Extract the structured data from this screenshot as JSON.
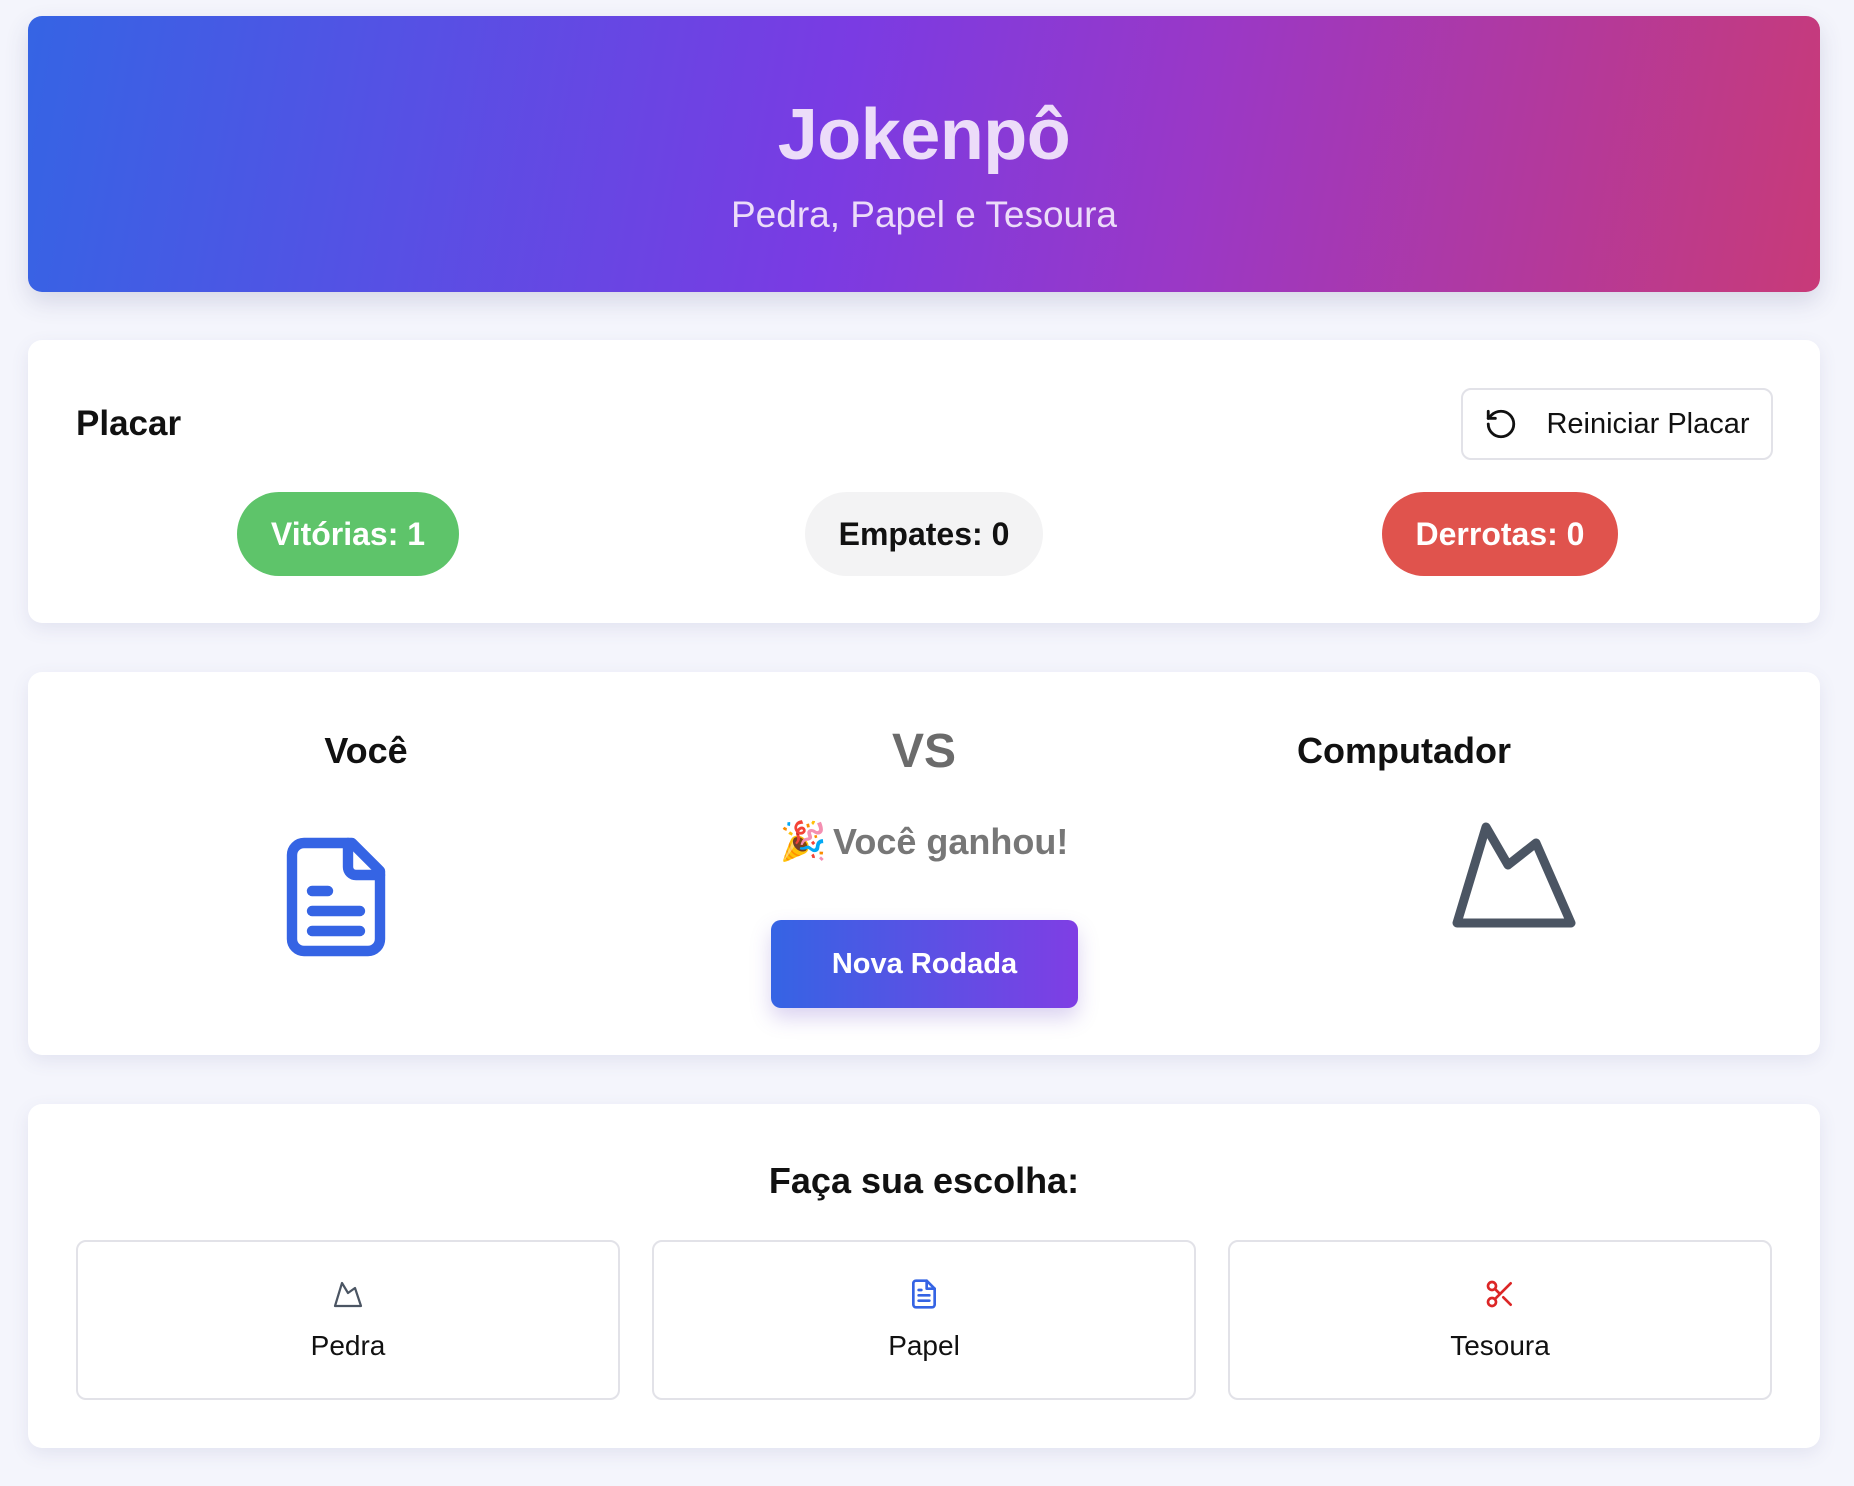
{
  "header": {
    "title": "Jokenpô",
    "subtitle": "Pedra, Papel e Tesoura"
  },
  "scoreboard": {
    "title": "Placar",
    "reset_label": "Reiniciar Placar",
    "reset_icon": "rotate-ccw-icon",
    "wins_label": "Vitórias: 1",
    "draws_label": "Empates: 0",
    "losses_label": "Derrotas: 0",
    "colors": {
      "win": "#5ec46a",
      "draw": "#f3f3f4",
      "loss": "#e0534d"
    }
  },
  "battle": {
    "player_label": "Você",
    "vs_label": "VS",
    "computer_label": "Computador",
    "player_choice_icon": "file-text-icon",
    "computer_choice_icon": "mountain-icon",
    "result_emoji": "🎉",
    "result_text": "Você ganhou!",
    "new_round_label": "Nova Rodada"
  },
  "choices": {
    "title": "Faça sua escolha:",
    "options": [
      {
        "label": "Pedra",
        "icon": "mountain-icon",
        "color": "#4b5563"
      },
      {
        "label": "Papel",
        "icon": "file-text-icon",
        "color": "#3564e4"
      },
      {
        "label": "Tesoura",
        "icon": "scissors-icon",
        "color": "#dc2626"
      }
    ]
  }
}
